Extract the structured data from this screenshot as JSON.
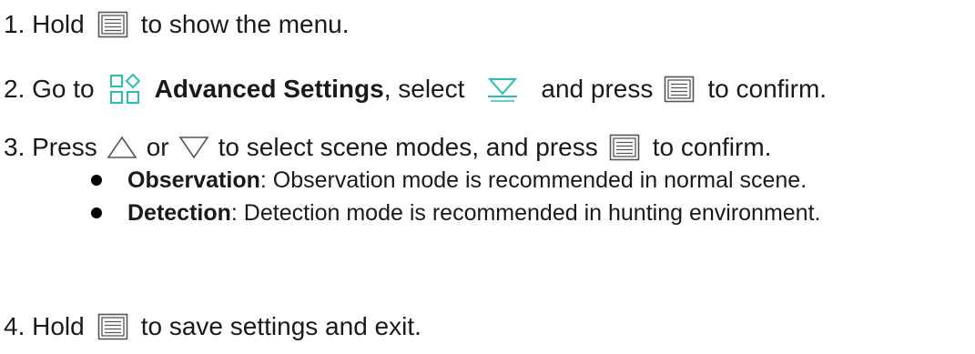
{
  "steps": {
    "s1": {
      "prefix": "1. Hold",
      "suffix": "to show the menu."
    },
    "s2": {
      "prefix": "2. Go to",
      "bold": "Advanced Settings",
      "mid": ", select",
      "and": "and press",
      "suffix": "to confirm."
    },
    "s3": {
      "prefix": "3. Press",
      "or": "or",
      "suffix": "to select scene modes, and press",
      "end": "to confirm."
    },
    "s4": {
      "prefix": "4. Hold",
      "suffix": "to save settings and exit."
    }
  },
  "bullets": [
    {
      "term": "Observation",
      "text": ": Observation mode is recommended in normal scene."
    },
    {
      "term": "Detection",
      "text": ": Detection mode is recommended in hunting environment."
    }
  ],
  "icons": {
    "menu": "menu-button-icon",
    "advanced": "advanced-settings-icon",
    "scene": "scene-mode-icon",
    "up": "up-triangle-icon",
    "down": "down-triangle-icon"
  },
  "colors": {
    "accent": "#2bbfb3",
    "text": "#1a1a1a"
  }
}
